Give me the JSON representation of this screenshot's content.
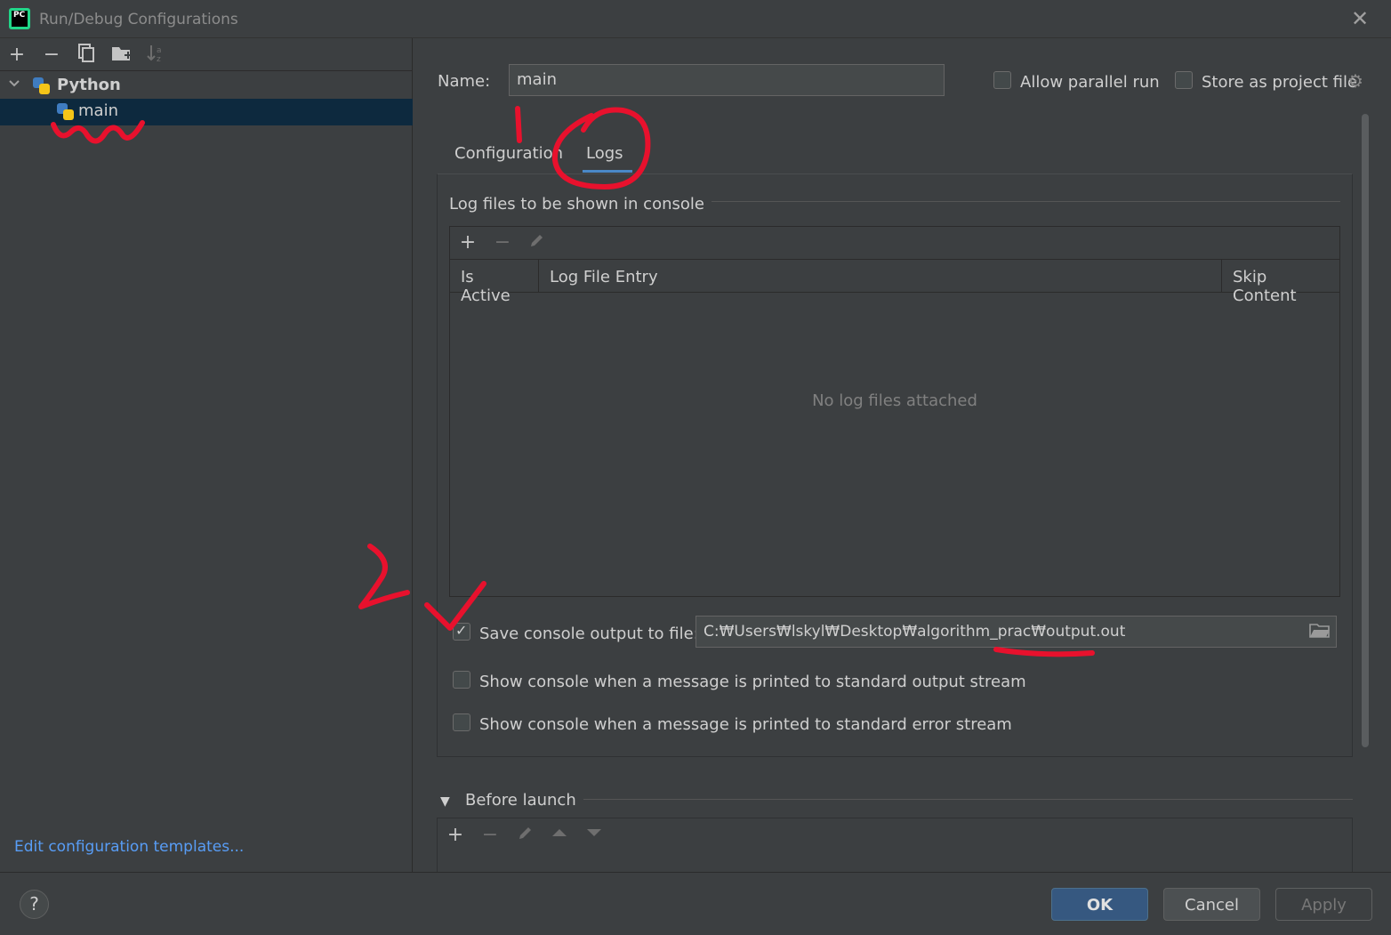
{
  "window": {
    "title": "Run/Debug Configurations",
    "app_icon_text": "PC",
    "close_icon": "close-icon"
  },
  "left_toolbar": {
    "add": "+",
    "remove": "−",
    "copy_icon": "copy-icon",
    "folder_icon": "new-folder-icon",
    "sort_icon": "sort-icon"
  },
  "tree": {
    "group_label": "Python",
    "item_label": "main"
  },
  "edit_templates_link": "Edit configuration templates...",
  "form": {
    "name_label": "Name:",
    "name_value": "main",
    "allow_parallel_label": "Allow parallel run",
    "allow_parallel_checked": false,
    "store_as_project_label": "Store as project file",
    "store_as_project_checked": false
  },
  "tabs": [
    {
      "label": "Configuration",
      "active": false
    },
    {
      "label": "Logs",
      "active": true
    }
  ],
  "logs": {
    "section_title": "Log files to be shown in console",
    "toolbar": {
      "add": "+",
      "remove": "−",
      "edit_icon": "pencil-icon"
    },
    "columns": [
      "Is Active",
      "Log File Entry",
      "Skip Content"
    ],
    "empty_text": "No log files attached",
    "save_output_label": "Save console output to file:",
    "save_output_checked": true,
    "save_output_path": "C:₩Users₩lskyl₩Desktop₩algorithm_prac₩output.out",
    "show_stdout_label": "Show console when a message is printed to standard output stream",
    "show_stdout_checked": false,
    "show_stderr_label": "Show console when a message is printed to standard error stream",
    "show_stderr_checked": false
  },
  "before_launch": {
    "title": "Before launch",
    "toolbar": {
      "add": "+",
      "remove": "−",
      "edit_icon": "pencil-icon",
      "up_icon": "move-up-icon",
      "down_icon": "move-down-icon"
    }
  },
  "buttons": {
    "help": "?",
    "ok": "OK",
    "cancel": "Cancel",
    "apply": "Apply"
  },
  "colors": {
    "background": "#3c3f41",
    "selection": "#0d293e",
    "link": "#589df6",
    "ok_button": "#365880",
    "annotation_red": "#e8112d"
  }
}
